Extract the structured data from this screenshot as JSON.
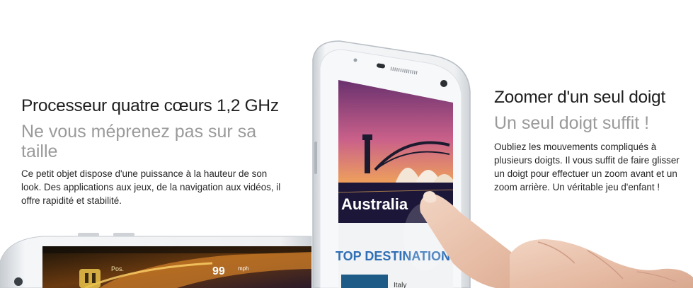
{
  "left_feature": {
    "title": "Processeur quatre cœurs 1,2 GHz",
    "subtitle": "Ne vous méprenez pas sur sa taille",
    "body": "Ce petit objet dispose d'une puissance à la hauteur de son look. Des applications aux jeux, de la navigation aux vidéos, il offre rapidité et stabilité."
  },
  "right_feature": {
    "title": "Zoomer d'un seul doigt",
    "subtitle": "Un seul doigt suffit !",
    "body": "Oubliez les mouvements compliqués à plusieurs doigts. Il vous suffit de faire glisser un doigt pour effectuer un zoom avant et un zoom arrière. Un véritable jeu d'enfant !"
  },
  "phone_screen": {
    "banner_label": "Australia",
    "section_heading": "TOP DESTINATIONS",
    "list_fragment": "Italy"
  },
  "game_screen": {
    "speed_value": "99",
    "speed_unit": "mph",
    "pos_label": "Pos."
  },
  "colors": {
    "title": "#1f1f1f",
    "subtitle": "#9a9a9a",
    "body": "#262626",
    "phone_body": "#eef0f2",
    "destinations_heading": "#2f6fb6"
  }
}
